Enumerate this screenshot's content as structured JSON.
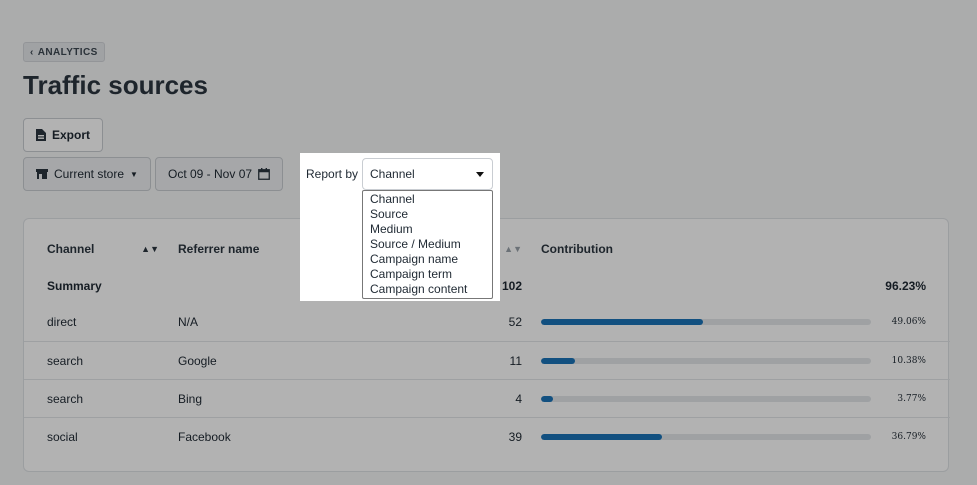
{
  "breadcrumb": {
    "label": "ANALYTICS"
  },
  "page": {
    "title": "Traffic sources"
  },
  "toolbar": {
    "export_label": "Export",
    "store_label": "Current store",
    "date_range": "Oct 09 - Nov 07"
  },
  "report_by": {
    "label": "Report by",
    "selected": "Channel",
    "options": [
      "Channel",
      "Source",
      "Medium",
      "Source / Medium",
      "Campaign name",
      "Campaign term",
      "Campaign content"
    ]
  },
  "table": {
    "headers": {
      "channel": "Channel",
      "referrer": "Referrer name",
      "contribution": "Contribution"
    },
    "summary": {
      "label": "Summary",
      "count": "102",
      "percent": "96.23%"
    },
    "rows": [
      {
        "channel": "direct",
        "referrer": "N/A",
        "count": "52",
        "percent": "49.06%",
        "share": 49.06
      },
      {
        "channel": "search",
        "referrer": "Google",
        "count": "11",
        "percent": "10.38%",
        "share": 10.38
      },
      {
        "channel": "search",
        "referrer": "Bing",
        "count": "4",
        "percent": "3.77%",
        "share": 3.77
      },
      {
        "channel": "social",
        "referrer": "Facebook",
        "count": "39",
        "percent": "36.79%",
        "share": 36.79
      }
    ]
  },
  "colors": {
    "bar_fill": "#1a73b8",
    "bar_track": "#e4e7ea",
    "overlay": "rgba(0,0,0,0.30)"
  }
}
